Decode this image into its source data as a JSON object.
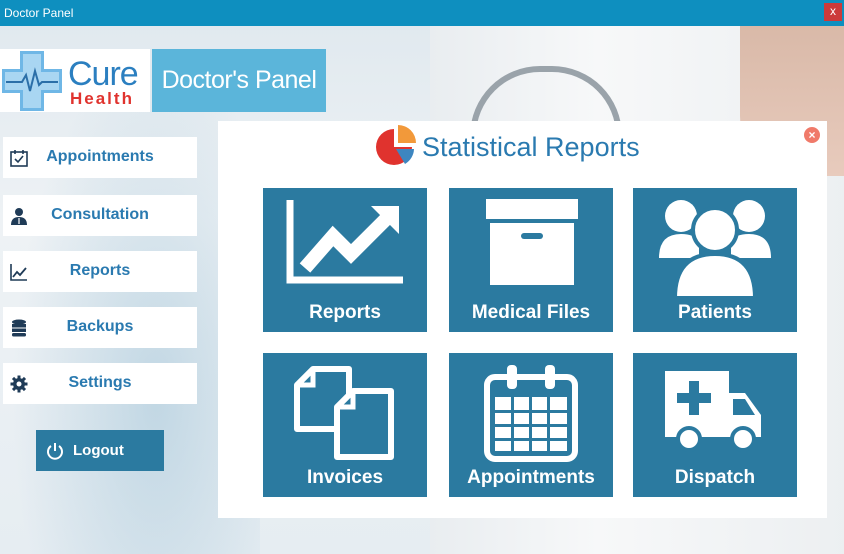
{
  "window": {
    "title": "Doctor Panel",
    "close_label": "x"
  },
  "logo": {
    "word1": "Cure",
    "word2": "Health"
  },
  "panel_title": "Doctor's Panel",
  "sidebar": {
    "items": [
      {
        "label": "Appointments",
        "icon": "calendar-check-icon"
      },
      {
        "label": "Consultation",
        "icon": "doctor-icon"
      },
      {
        "label": "Reports",
        "icon": "line-chart-icon"
      },
      {
        "label": "Backups",
        "icon": "database-icon"
      },
      {
        "label": "Settings",
        "icon": "gear-icon"
      }
    ],
    "logout_label": "Logout"
  },
  "main": {
    "heading": "Statistical Reports",
    "tiles": [
      {
        "label": "Reports",
        "icon": "trend-up-chart-icon"
      },
      {
        "label": "Medical Files",
        "icon": "archive-box-icon"
      },
      {
        "label": "Patients",
        "icon": "users-group-icon"
      },
      {
        "label": "Invoices",
        "icon": "documents-icon"
      },
      {
        "label": "Appointments",
        "icon": "calendar-icon"
      },
      {
        "label": "Dispatch",
        "icon": "ambulance-icon"
      }
    ]
  },
  "colors": {
    "titlebar": "#0e8fbf",
    "accent": "#2b7aa0",
    "text_blue": "#2a7ab0",
    "panel_title_bg": "#5bb5da",
    "logo_red": "#e0332e"
  }
}
